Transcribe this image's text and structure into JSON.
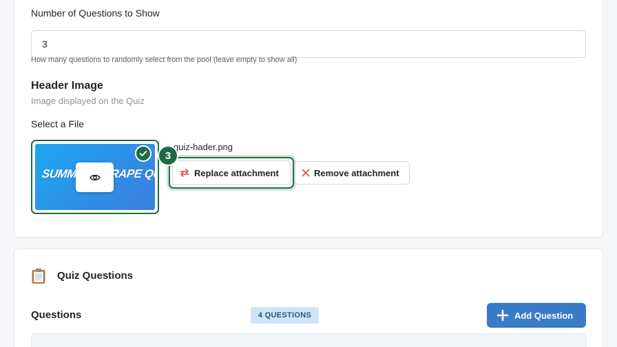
{
  "questions_to_show": {
    "label": "Number of Questions to Show",
    "value": "3",
    "help": "How many questions to randomly select from the pool (leave empty to show all)"
  },
  "header_image": {
    "title": "Header Image",
    "subtitle": "Image displayed on the Quiz",
    "select_label": "Select a File",
    "thumbnail_text": "SUMMER SCRAPE QUIZ",
    "filename": "quiz-hader.png",
    "step_number": "3",
    "replace_label": "Replace attachment",
    "remove_label": "Remove attachment",
    "icons": {
      "preview": "eye-icon",
      "selected": "check-icon",
      "replace": "swap-icon",
      "remove": "close-icon"
    }
  },
  "quiz_questions": {
    "title": "Quiz Questions",
    "questions_label": "Questions",
    "count_badge": "4 QUESTIONS",
    "add_button": "Add Question"
  },
  "colors": {
    "accent_green": "#1e6b45",
    "primary_blue": "#3a7bc8",
    "badge_bg": "#cfe5f7",
    "remove_red": "#e5484d"
  }
}
